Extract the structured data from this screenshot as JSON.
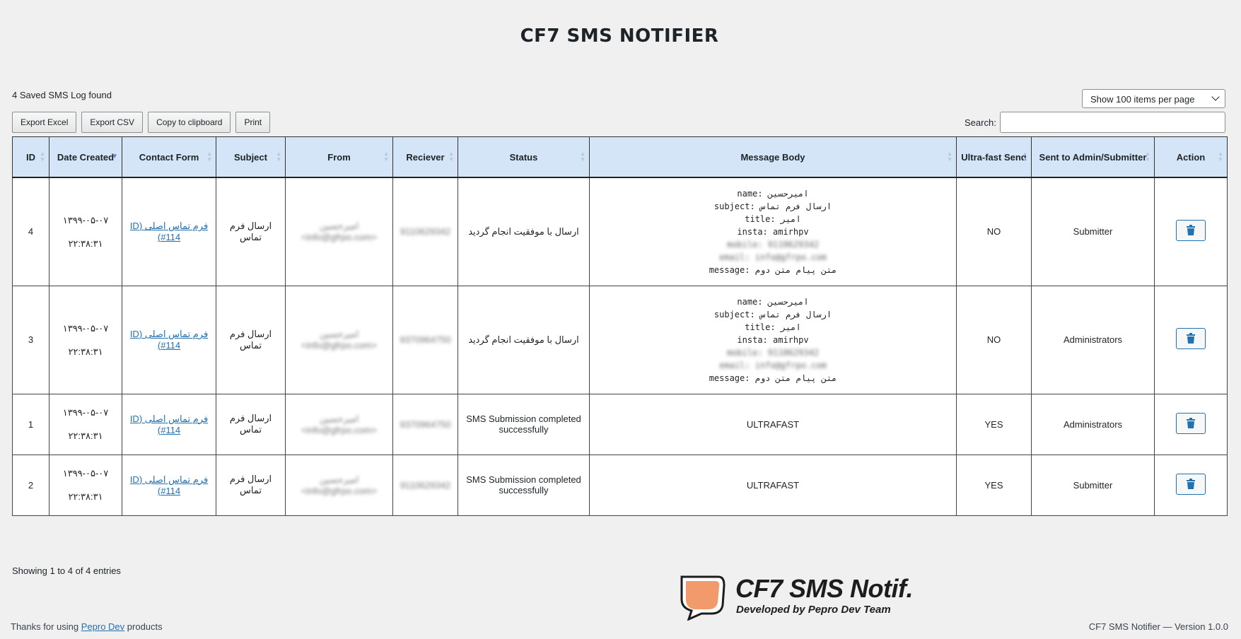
{
  "page": {
    "title": "CF7 SMS NOTIFIER"
  },
  "log": {
    "found_text": "4 Saved SMS Log found"
  },
  "per_page": {
    "selected": "Show 100 items per page"
  },
  "toolbar": {
    "export_excel": "Export Excel",
    "export_csv": "Export CSV",
    "copy_clipboard": "Copy to clipboard",
    "print": "Print"
  },
  "search": {
    "label": "Search:",
    "value": ""
  },
  "table": {
    "columns": [
      "ID",
      "Date Created",
      "Contact Form",
      "Subject",
      "From",
      "Reciever",
      "Status",
      "Message Body",
      "Ultra-fast Send",
      "Sent to Admin/Submitter",
      "Action"
    ],
    "rows": [
      {
        "id": "4",
        "date": "۱۳۹۹-۰۵-۰۷",
        "time": "۲۲:۳۸:۳۱",
        "contact_form": "فرم تماس اصلی (ID #114)",
        "subject": "ارسال فرم تماس",
        "from": "امیرحسین <info@gfrpo.com>",
        "receiver": "9110629342",
        "status": "ارسال با موفقیت انجام گردید",
        "body_lines": [
          "name: امیرحسین",
          "subject: ارسال فرم تماس",
          "title: امیر",
          "insta: amirhpv",
          "mobile: 9110629342",
          "email: info@gfrpo.com",
          "message: متن پیام متن دوم"
        ],
        "ultrafast": "NO",
        "sent_to": "Submitter"
      },
      {
        "id": "3",
        "date": "۱۳۹۹-۰۵-۰۷",
        "time": "۲۲:۳۸:۳۱",
        "contact_form": "فرم تماس اصلی (ID #114)",
        "subject": "ارسال فرم تماس",
        "from": "امیرحسین <info@gfrpo.com>",
        "receiver": "9370964750",
        "status": "ارسال با موفقیت انجام گردید",
        "body_lines": [
          "name: امیرحسین",
          "subject: ارسال فرم تماس",
          "title: امیر",
          "insta: amirhpv",
          "mobile: 9110629342",
          "email: info@gfrpo.com",
          "message: متن پیام متن دوم"
        ],
        "ultrafast": "NO",
        "sent_to": "Administrators"
      },
      {
        "id": "1",
        "date": "۱۳۹۹-۰۵-۰۷",
        "time": "۲۲:۳۸:۳۱",
        "contact_form": "فرم تماس اصلی (ID #114)",
        "subject": "ارسال فرم تماس",
        "from": "امیرحسین <info@gfrpo.com>",
        "receiver": "9370964750",
        "status": "SMS Submission completed successfully",
        "body_lines": [
          "ULTRAFAST"
        ],
        "ultrafast": "YES",
        "sent_to": "Administrators"
      },
      {
        "id": "2",
        "date": "۱۳۹۹-۰۵-۰۷",
        "time": "۲۲:۳۸:۳۱",
        "contact_form": "فرم تماس اصلی (ID #114)",
        "subject": "ارسال فرم تماس",
        "from": "امیرحسین <info@gfrpo.com>",
        "receiver": "9110629342",
        "status": "SMS Submission completed successfully",
        "body_lines": [
          "ULTRAFAST"
        ],
        "ultrafast": "YES",
        "sent_to": "Submitter"
      }
    ]
  },
  "pagination": {
    "showing": "Showing 1 to 4 of 4 entries"
  },
  "brand": {
    "name": "CF7 SMS Notif.",
    "tagline": "Developed by Pepro Dev Team"
  },
  "footer": {
    "thanks_prefix": "Thanks for using",
    "link": "Pepro Dev",
    "thanks_suffix": "products",
    "version": "CF7 SMS Notifier — Version 1.0.0"
  },
  "colors": {
    "header_bg": "#d4e5f7",
    "link": "#2271b1",
    "page_bg": "#f0f0f1",
    "logo_orange": "#f39a6c"
  }
}
